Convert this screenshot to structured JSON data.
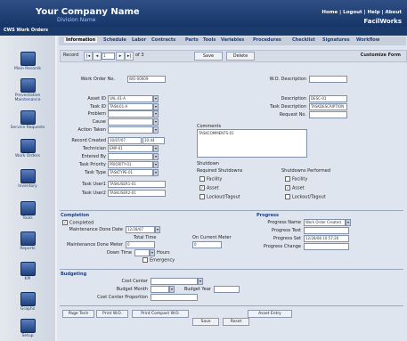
{
  "header": {
    "company": "Your Company Name",
    "division": "Division Name",
    "nav": "Home | Logout | Help | About",
    "brand": "FacilWorks",
    "breadcrumb": "CWS Work Orders"
  },
  "sidebar": {
    "items": [
      {
        "label": "Main Records"
      },
      {
        "label": "Preventative Maintenance"
      },
      {
        "label": "Service Requests"
      },
      {
        "label": "Work Orders"
      },
      {
        "label": "Inventory"
      },
      {
        "label": "Tools"
      },
      {
        "label": "Reports"
      },
      {
        "label": "KPI"
      },
      {
        "label": "Graphs"
      },
      {
        "label": "Setup"
      }
    ]
  },
  "tabs": [
    "Information",
    "Schedule",
    "Labor",
    "Contracts",
    "Parts",
    "Tools",
    "Variables",
    "Procedures",
    "Checklist",
    "Signatures",
    "Workflow"
  ],
  "toolbar": {
    "record_label": "Record",
    "record_num": "1",
    "of_text": "of 3",
    "save": "Save",
    "delete": "Delete",
    "customize": "Customize Form"
  },
  "form": {
    "work_order_no": {
      "label": "Work Order No.",
      "value": "WO-00009"
    },
    "wo_description": {
      "label": "W.O. Description",
      "value": ""
    },
    "asset_id": {
      "label": "Asset ID",
      "value": "VAL-01-A"
    },
    "task_id": {
      "label": "Task ID",
      "value": "TASK-01-A"
    },
    "problem": {
      "label": "Problem",
      "value": ""
    },
    "cause": {
      "label": "Cause",
      "value": ""
    },
    "action_taken": {
      "label": "Action Taken",
      "value": ""
    },
    "record_created": {
      "label": "Record Created",
      "value": "10/07/07",
      "time": "10:44"
    },
    "technician": {
      "label": "Technician",
      "value": "EMP-01"
    },
    "entered_by": {
      "label": "Entered By",
      "value": ""
    },
    "task_priority": {
      "label": "Task Priority",
      "value": "PRIORITY-01"
    },
    "task_type": {
      "label": "Task Type",
      "value": "TASKTYPE-01"
    },
    "task_user1": {
      "label": "Task User1",
      "value": "TASKUSER1-01"
    },
    "task_user2": {
      "label": "Task User2",
      "value": "TASKUSER2-01"
    },
    "description": {
      "label": "Description",
      "value": "DESC-01"
    },
    "task_description": {
      "label": "Task Description",
      "value": "TASKDESCRIPTION"
    },
    "request_no": {
      "label": "Request No.",
      "value": ""
    },
    "comments": {
      "label": "Comments",
      "value": "TASKCOMMENTS-01"
    }
  },
  "shutdown": {
    "title": "Shutdown",
    "required_label": "Required Shutdowns",
    "performed_label": "Shutdowns Performed",
    "options": [
      "Facility",
      "Asset",
      "Lockout/Tagout"
    ],
    "required_checked": [
      false,
      true,
      false
    ],
    "performed_checked": [
      false,
      true,
      false
    ]
  },
  "completion": {
    "title": "Completion",
    "completed_label": "Completed",
    "done_date_label": "Maintenance Done Date",
    "done_date": "12/28/07",
    "total_time_label": "Total Time",
    "meter_label": "Maintenance Done Meter",
    "meter_value": "0",
    "current_meter_label": "On Current Meter",
    "current_meter_value": "0",
    "down_time_label": "Down Time",
    "down_time_value": "1.5",
    "hours_label": "Hours",
    "emergency_label": "Emergency"
  },
  "progress": {
    "title": "Progress",
    "name_label": "Progress Name",
    "name_value": "Work Order Created",
    "text_label": "Progress Text",
    "set_label": "Progress Set",
    "set_value": "12/28/08 10:57:26",
    "change_label": "Progress Change"
  },
  "budgeting": {
    "title": "Budgeting",
    "cost_center_label": "Cost Center",
    "budget_month_label": "Budget Month",
    "budget_year_label": "Budget Year",
    "proportion_label": "Cost Center Proportion"
  },
  "buttons": {
    "page_tech": "Page Tech",
    "print_wo": "Print W.O.",
    "print_compact": "Print Compact W.O.",
    "asset_entry": "Asset Entry",
    "save": "Save",
    "reset": "Reset"
  }
}
